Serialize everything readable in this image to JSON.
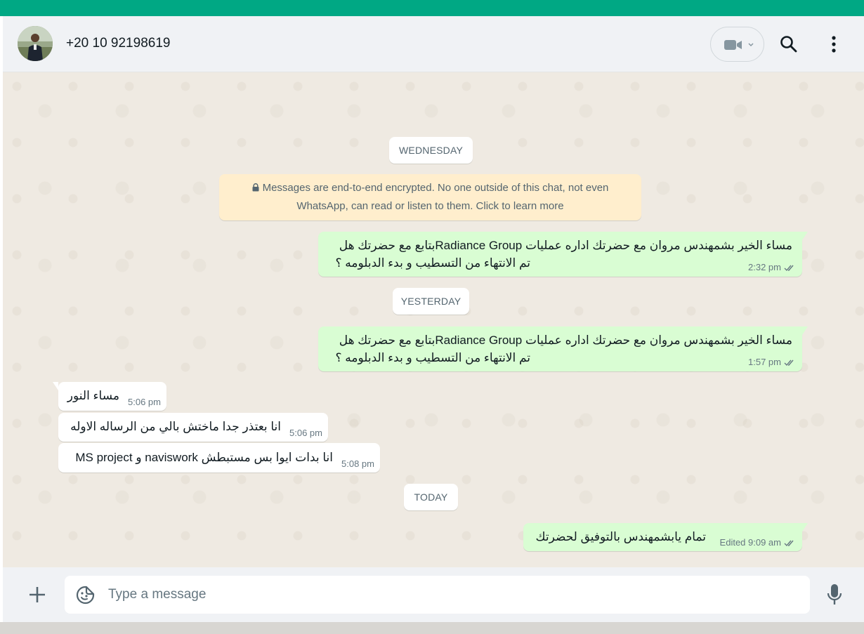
{
  "header": {
    "contact_name": "+20 10 92198619"
  },
  "date_separators": [
    "WEDNESDAY",
    "YESTERDAY",
    "TODAY"
  ],
  "encryption_notice": {
    "line1": "Messages are end-to-end encrypted. No one outside of this chat, not even",
    "line2": "WhatsApp, can read or listen to them. Click to learn more"
  },
  "messages": [
    {
      "direction": "outgoing",
      "line1": "مساء الخير بشمهندس مروان مع  حضرتك اداره عمليات Radiance Groupبتابع مع حضرتك هل",
      "line2": "تم الانتهاء من التسطيب و بدء الدبلومه ؟",
      "time": "2:32 pm",
      "status": "read"
    },
    {
      "direction": "outgoing",
      "line1": "مساء الخير بشمهندس مروان مع  حضرتك اداره عمليات Radiance Groupبتابع مع حضرتك هل",
      "line2": "تم الانتهاء من التسطيب و بدء الدبلومه ؟",
      "time": "1:57 pm",
      "status": "read"
    },
    {
      "direction": "incoming",
      "text": "مساء النور",
      "time": "5:06 pm"
    },
    {
      "direction": "incoming",
      "text": "انا بعتذر جدا ماختش بالي من الرساله الاوله",
      "time": "5:06 pm"
    },
    {
      "direction": "incoming",
      "text": "انا بدات ايوا بس مستبطش naviswork و MS project",
      "time": "5:08 pm"
    },
    {
      "direction": "outgoing",
      "text": "تمام يابشمهندس بالتوفيق لحضرتك",
      "time": "Edited 9:09 am",
      "status": "read"
    }
  ],
  "composer": {
    "placeholder": "Type a message"
  },
  "colors": {
    "brand_green": "#00a884",
    "outgoing_bubble": "#d9fdd3",
    "incoming_bubble": "#ffffff",
    "chat_background": "#efeae2",
    "encryption_notice_bg": "#ffeecd"
  },
  "icons": [
    "video-call-icon",
    "chevron-down-icon",
    "search-icon",
    "menu-icon",
    "plus-icon",
    "emoji-icon",
    "mic-icon",
    "lock-icon",
    "double-check-icon"
  ]
}
